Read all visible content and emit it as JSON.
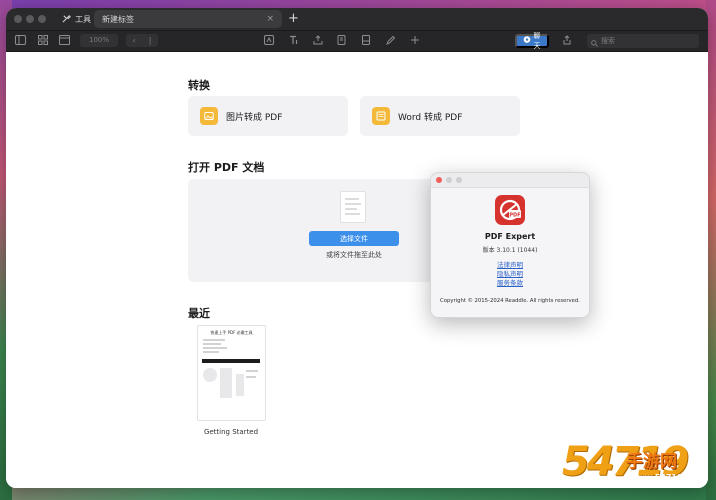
{
  "tabs": {
    "tools_label": "工具",
    "new_tab_label": "新建标签",
    "close_glyph": "×",
    "add_glyph": "+"
  },
  "toolbar": {
    "zoom": "100%",
    "chat_label": "聊天",
    "search_placeholder": "搜索"
  },
  "convert": {
    "title": "转换",
    "image_to_pdf": "图片转成 PDF",
    "word_to_pdf": "Word 转成 PDF"
  },
  "open": {
    "title": "打开 PDF 文档",
    "choose_button": "选择文件",
    "drag_hint": "或将文件拖至此处"
  },
  "recent": {
    "title": "最近",
    "thumb_title": "快速上手 PDF 必嫩工具",
    "item_caption": "Getting Started"
  },
  "about": {
    "app_name": "PDF Expert",
    "version": "版本 3.10.1 (1044)",
    "links": [
      "法律声明",
      "隐私声明",
      "服务条款"
    ],
    "copyright": "Copyright © 2015-2024 Readdle. All rights reserved."
  },
  "watermark": {
    "number": "54719",
    "site_cn": "手游网",
    "url": "www.54719.com"
  },
  "colors": {
    "accent_blue": "#3d90ea",
    "card_icon_yellow": "#f5b93a",
    "logo_red": "#d6322e",
    "link_blue": "#2a62c8",
    "close_red": "#ee5f57"
  }
}
